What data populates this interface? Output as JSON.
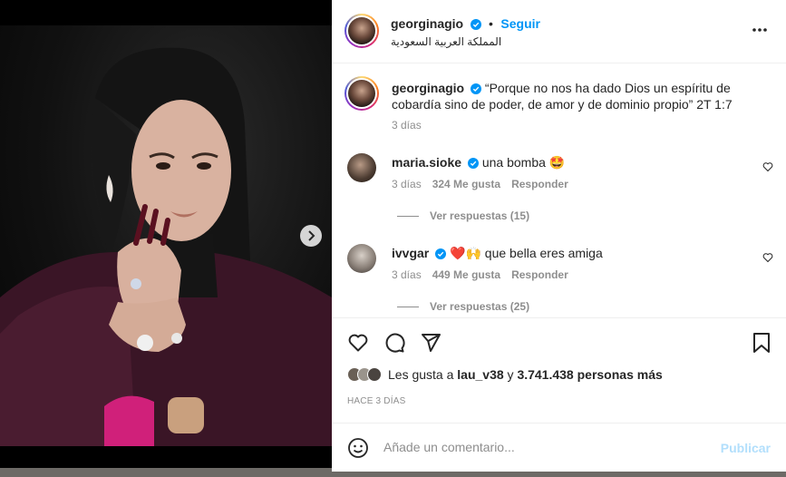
{
  "post": {
    "author": "georginagio",
    "follow_label": "Seguir",
    "separator": "•",
    "location": "المملكة العربية السعودية",
    "more_icon": "more-horizontal-icon",
    "caption": "“Porque no nos ha dado Dios un espíritu de cobardía sino de poder, de amor y de dominio propio” 2T 1:7",
    "caption_time": "3 días"
  },
  "comments": [
    {
      "username": "maria.sioke",
      "text": "una bomba 🤩",
      "time": "3 días",
      "likes": "324 Me gusta",
      "reply_label": "Responder",
      "view_replies": "Ver respuestas (15)"
    },
    {
      "username": "ivvgar",
      "text": "❤️🙌 que bella eres amiga",
      "time": "3 días",
      "likes": "449 Me gusta",
      "reply_label": "Responder",
      "view_replies": "Ver respuestas (25)"
    }
  ],
  "likes": {
    "prefix": "Les gusta a ",
    "user": "lau_v38",
    "middle": " y ",
    "count": "3.741.438 personas más"
  },
  "posted_ago": "HACE 3 DÍAS",
  "add_comment": {
    "placeholder": "Añade un comentario...",
    "publish_label": "Publicar"
  },
  "colors": {
    "accent": "#0095f6",
    "publish_disabled": "#b2dffc",
    "muted": "#8e8e8e",
    "text": "#262626"
  }
}
